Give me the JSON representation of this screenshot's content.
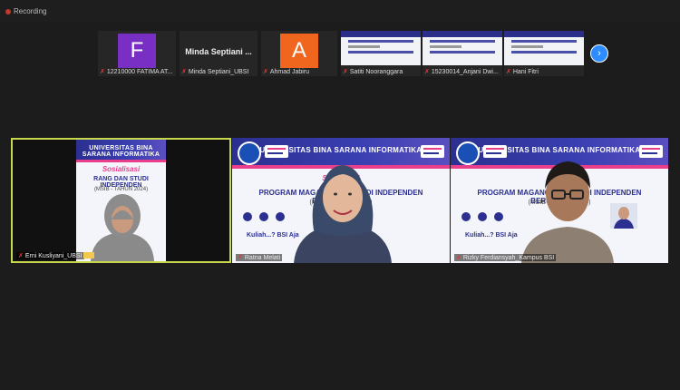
{
  "recording": {
    "label": "Recording"
  },
  "strip": {
    "raise_hand_icon": "raise-hand-icon",
    "participants": [
      {
        "initial": "F",
        "color": "#7a2fc4",
        "name": "12210000 FATIMA AT..."
      },
      {
        "display_name": "Minda Septiani ...",
        "name": "Minda Septiani_UBSI"
      },
      {
        "initial": "A",
        "color": "#f0661e",
        "name": "Ahmad Jabiru"
      },
      {
        "name": "Satiti Nooranggara"
      },
      {
        "name": "15230014_Anjani Dwi..."
      },
      {
        "name": "Hani Fitri"
      }
    ],
    "next_icon": "chevron-right-icon"
  },
  "tiles": [
    {
      "name": "Erni Kusliyani_UBSI",
      "banner": "UNIVERSITAS BINA SARANA INFORMATIKA",
      "script": "Sosialisasi",
      "headline": "RANG DAN STUDI INDEPENDEN",
      "sub": "(MSIB - TAHUN 2024)"
    },
    {
      "name": "Ratna Melati",
      "banner": "UNIVERSITAS BINA SARANA INFORMATIKA",
      "script": "Sosialisasi",
      "headline": "PROGRAM MAGANG DAN STUDI INDEPENDEN BERSERTIFIKAT",
      "sub": "(MSIB - TAHUN 2024)",
      "tagline": "Kuliah...? BSI Aja"
    },
    {
      "name": "Rizky Ferdiansyah_Kampus BSI",
      "banner": "UNIVERSITAS BINA SARANA INFORMATIKA",
      "headline": "PROGRAM MAGANG DAN STUDI INDEPENDEN BERSERTIFIKAT",
      "sub": "(MSIB - TAHUN 2024)",
      "tagline": "Kuliah...? BSI Aja"
    }
  ]
}
